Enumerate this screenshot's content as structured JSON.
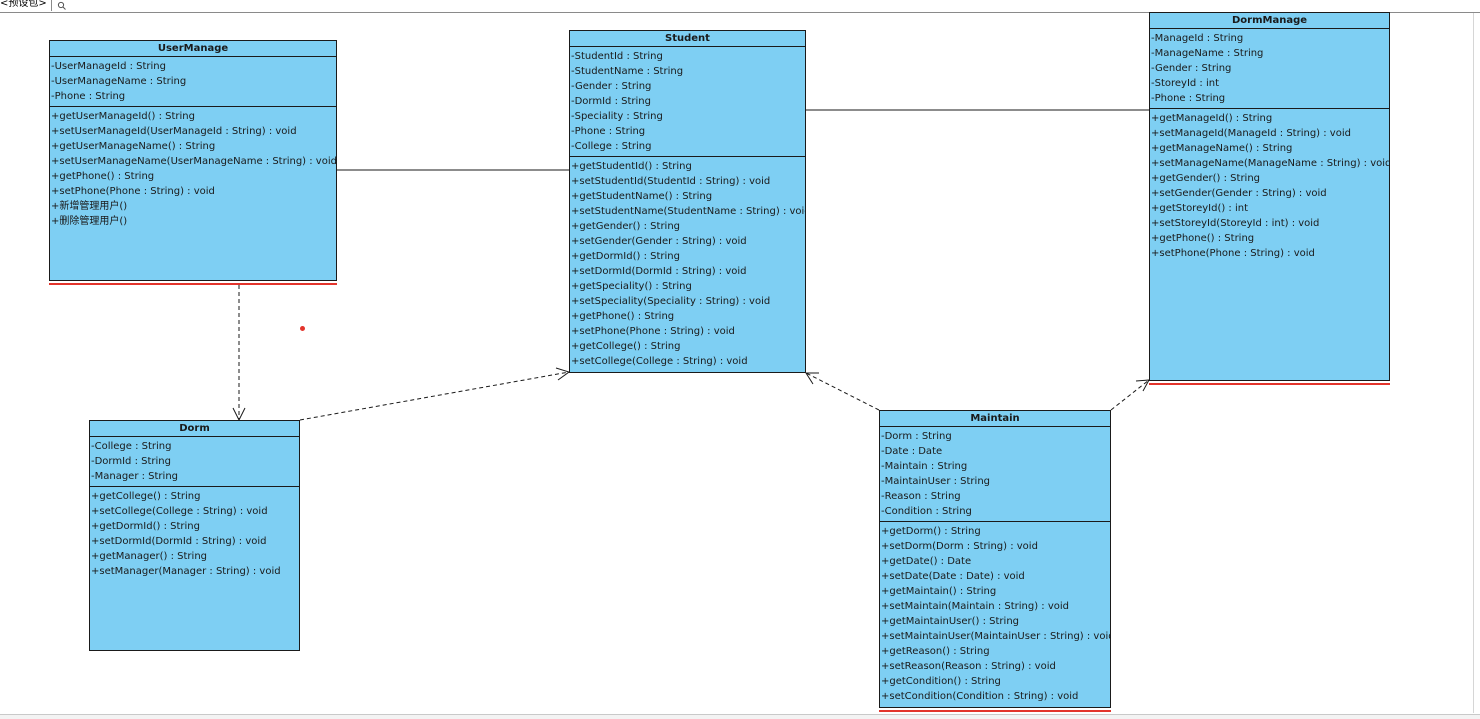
{
  "window": {
    "tab_label": "<预设包>"
  },
  "classes": [
    {
      "id": "usermanage",
      "name": "UserManage",
      "attributes": [
        "-UserManageId : String",
        "-UserManageName : String",
        "-Phone : String"
      ],
      "operations": [
        "+getUserManageId() : String",
        "+setUserManageId(UserManageId : String) : void",
        "+getUserManageName() : String",
        "+setUserManageName(UserManageName : String) : void",
        "+getPhone() : String",
        "+setPhone(Phone : String) : void",
        "+新增管理用户()",
        "+删除管理用户()"
      ]
    },
    {
      "id": "student",
      "name": "Student",
      "attributes": [
        "-StudentId : String",
        "-StudentName : String",
        "-Gender : String",
        "-DormId : String",
        "-Speciality : String",
        "-Phone : String",
        "-College : String"
      ],
      "operations": [
        "+getStudentId() : String",
        "+setStudentId(StudentId : String) : void",
        "+getStudentName() : String",
        "+setStudentName(StudentName : String) : void",
        "+getGender() : String",
        "+setGender(Gender : String) : void",
        "+getDormId() : String",
        "+setDormId(DormId : String) : void",
        "+getSpeciality() : String",
        "+setSpeciality(Speciality : String) : void",
        "+getPhone() : String",
        "+setPhone(Phone : String) : void",
        "+getCollege() : String",
        "+setCollege(College : String) : void"
      ]
    },
    {
      "id": "dormmanage",
      "name": "DormManage",
      "attributes": [
        "-ManageId : String",
        "-ManageName : String",
        "-Gender : String",
        "-StoreyId : int",
        "-Phone : String"
      ],
      "operations": [
        "+getManageId() : String",
        "+setManageId(ManageId : String) : void",
        "+getManageName() : String",
        "+setManageName(ManageName : String) : void",
        "+getGender() : String",
        "+setGender(Gender : String) : void",
        "+getStoreyId() : int",
        "+setStoreyId(StoreyId : int) : void",
        "+getPhone() : String",
        "+setPhone(Phone : String) : void"
      ]
    },
    {
      "id": "dorm",
      "name": "Dorm",
      "attributes": [
        "-College : String",
        "-DormId : String",
        "-Manager : String"
      ],
      "operations": [
        "+getCollege() : String",
        "+setCollege(College : String) : void",
        "+getDormId() : String",
        "+setDormId(DormId : String) : void",
        "+getManager() : String",
        "+setManager(Manager : String) : void"
      ]
    },
    {
      "id": "maintain",
      "name": "Maintain",
      "attributes": [
        "-Dorm : String",
        "-Date : Date",
        "-Maintain : String",
        "-MaintainUser : String",
        "-Reason : String",
        "-Condition : String"
      ],
      "operations": [
        "+getDorm() : String",
        "+setDorm(Dorm : String) : void",
        "+getDate() : Date",
        "+setDate(Date : Date) : void",
        "+getMaintain() : String",
        "+setMaintain(Maintain : String) : void",
        "+getMaintainUser() : String",
        "+setMaintainUser(MaintainUser : String) : void",
        "+getReason() : String",
        "+setReason(Reason : String) : void",
        "+getCondition() : String",
        "+setCondition(Condition : String) : void"
      ]
    }
  ],
  "relationships": [
    {
      "from": "usermanage",
      "to": "student",
      "kind": "association"
    },
    {
      "from": "student",
      "to": "dormmanage",
      "kind": "association"
    },
    {
      "from": "usermanage",
      "to": "dorm",
      "kind": "dependency"
    },
    {
      "from": "dorm",
      "to": "student",
      "kind": "dependency"
    },
    {
      "from": "maintain",
      "to": "student",
      "kind": "dependency"
    },
    {
      "from": "maintain",
      "to": "dormmanage",
      "kind": "dependency"
    }
  ],
  "colors": {
    "class_fill": "#7ecff3",
    "class_border": "#1a1a1a",
    "selection_underline": "#e3342c",
    "connector": "#1a1a1a"
  },
  "icons": {
    "search": "search-icon"
  }
}
